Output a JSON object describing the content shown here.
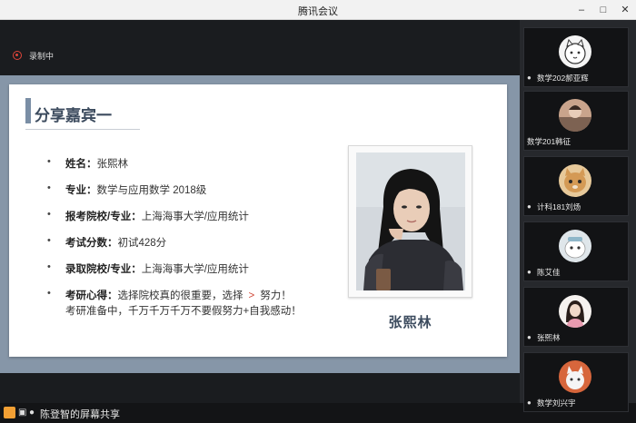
{
  "window": {
    "title": "腾讯会议"
  },
  "recording": {
    "label": "录制中",
    "color": "#e0453a"
  },
  "slide": {
    "title": "分享嘉宾一",
    "bullets": [
      {
        "key": "姓名：",
        "value": "张熙林"
      },
      {
        "key": "专业：",
        "value": "数学与应用数学 2018级"
      },
      {
        "key": "报考院校/专业：",
        "value": "上海海事大学/应用统计"
      },
      {
        "key": "考试分数：",
        "value": "初试428分"
      },
      {
        "key": "录取院校/专业：",
        "value": "上海海事大学/应用统计"
      },
      {
        "key": "考研心得：",
        "value": "选择院校真的很重要，选择",
        "arrow": ">",
        "value_after": "努力！",
        "continuation": "考研准备中，千万千万千万不要假努力+自我感动！"
      }
    ],
    "photo_caption": "张熙林"
  },
  "bottom_bar": {
    "share_label": "陈登智的屏幕共享"
  },
  "participants": [
    {
      "name": "数学202郝亚辉",
      "avatar": "cartoon-cat-avatar",
      "mic": true
    },
    {
      "name": "数学201韩征",
      "avatar": "photo-avatar",
      "mic": false
    },
    {
      "name": "计科181刘炀",
      "avatar": "cat-avatar",
      "mic": true
    },
    {
      "name": "陈艾佳",
      "avatar": "cartoon-avatar",
      "mic": true
    },
    {
      "name": "张熙林",
      "avatar": "girl-avatar",
      "mic": true
    },
    {
      "name": "数学刘兴宇",
      "avatar": "cat-cartoon-avatar",
      "mic": true
    }
  ],
  "colors": {
    "accent": "#3c4b5e",
    "slide_band": "#8696a8",
    "share_icon": "#f3a034"
  }
}
